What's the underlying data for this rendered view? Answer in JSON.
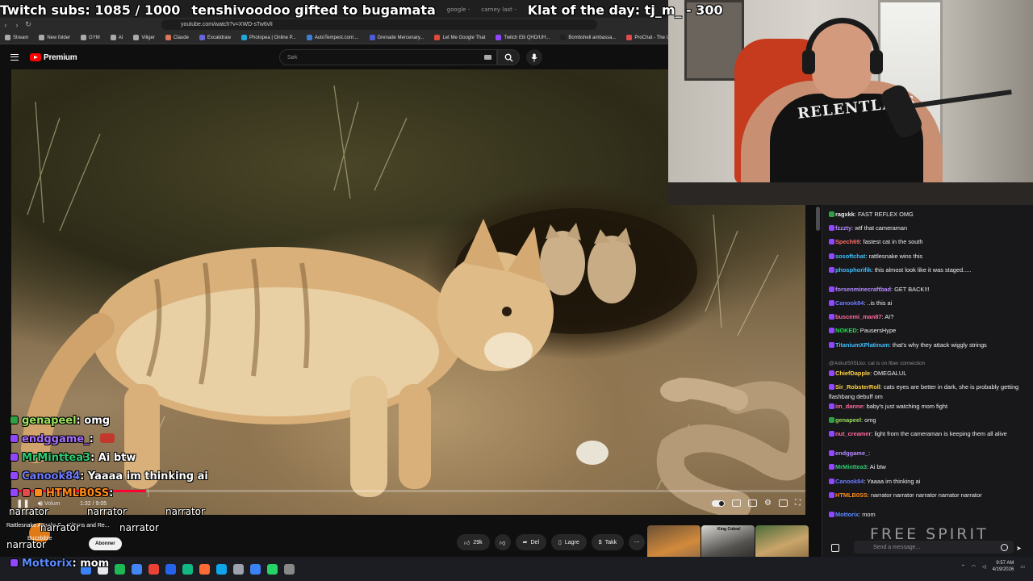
{
  "overlay": {
    "subs": "Twitch subs: 1085 / 1000",
    "gift": "tenshivoodoo gifted to bugamata",
    "klat": "Klat of the day: tj_m_ - 300",
    "ghost_tabs": [
      "google -",
      "carney last -"
    ]
  },
  "browser": {
    "url": "youtube.com/watch?v=XWD-sTw6vlI",
    "bookmarks": [
      {
        "label": "Stream",
        "color": "#aaaaaa"
      },
      {
        "label": "New folder",
        "color": "#aaaaaa"
      },
      {
        "label": "GYM",
        "color": "#aaaaaa"
      },
      {
        "label": "AI",
        "color": "#aaaaaa"
      },
      {
        "label": "Viliger",
        "color": "#aaaaaa"
      },
      {
        "label": "Claude",
        "color": "#d97757"
      },
      {
        "label": "Excalidraw",
        "color": "#6965db"
      },
      {
        "label": "Photopea | Online P...",
        "color": "#1fa5d8"
      },
      {
        "label": "AutoTempest.com:...",
        "color": "#3b7ed8"
      },
      {
        "label": "Grenade Mercenary...",
        "color": "#4e5cd6"
      },
      {
        "label": "Let Me Google That",
        "color": "#e24a36"
      },
      {
        "label": "Twitch Elli QHD/UH...",
        "color": "#9146ff"
      },
      {
        "label": "Bombshell ambassa...",
        "color": "#222222"
      },
      {
        "label": "ProChat - The Unifi...",
        "color": "#e14b4b"
      }
    ]
  },
  "youtube": {
    "logo": "Premium",
    "search_placeholder": "Søk",
    "time": "1:32 / 9:05",
    "progress_fraction": 0.17,
    "actions": {
      "likes": "29k",
      "share": "Del",
      "save": "Lagre",
      "thanks": "Takk"
    },
    "subscribe": "Abonner",
    "channel": "Buzzbible",
    "thumb_label": "King Cobra!"
  },
  "overlay_chat": [
    {
      "user": "genapeel",
      "message": ": omg",
      "color": "#9be15d",
      "badge": "#2ea043"
    },
    {
      "user": "endggame_",
      "message": ":",
      "color": "#a970ff",
      "badge": "#9146ff"
    },
    {
      "user": "MrMinttea3",
      "message": ": Ai btw",
      "color": "#2ecc71",
      "badge": "#9146ff"
    },
    {
      "user": "Canook84",
      "message": ": Yaaaa im thinking ai",
      "color": "#6e7bff",
      "badge": "#9146ff"
    },
    {
      "user": "HTMLB0SS",
      "message": ":",
      "color": "#ff8c1a",
      "badge": "#9146ff"
    },
    {
      "user": "Mottorix",
      "message": ": mom",
      "color": "#5b8cff",
      "badge": "#9146ff"
    }
  ],
  "overlay_narrator": [
    "narrator",
    "narrator",
    "narrator",
    "narrator",
    "narrator",
    "narrator"
  ],
  "overlay_misc": {
    "volume": "Volum",
    "title_ghost": "Rattlesnake Attacks S... Kittens and Re..."
  },
  "chat": {
    "messages": [
      {
        "user": "ragxkk",
        "text": ": FAST REFLEX OMG",
        "color": "#efeff1",
        "badge": "#2ea043"
      },
      {
        "user": "fzzzty",
        "text": ": wtf that cameraman",
        "color": "#b58cff",
        "badge": "#9146ff"
      },
      {
        "user": "Spech69",
        "text": ": fastest cat in the south",
        "color": "#ff6b6b",
        "badge": "#9146ff"
      },
      {
        "user": "sosoftchat",
        "text": ": rattlesnake wins this",
        "color": "#3ec1ff",
        "badge": "#9146ff"
      },
      {
        "user": "phosphorifik",
        "text": ": this almost look like it was staged.....",
        "color": "#3ec1ff",
        "badge": "#9146ff"
      },
      {
        "user": "forsenminecraftbad",
        "text": ":  GET BACK!!!",
        "color": "#b58cff",
        "badge": "#9146ff"
      },
      {
        "user": "Canook84",
        "text": ": ..is this ai",
        "color": "#6e7bff",
        "badge": "#9146ff"
      },
      {
        "user": "buscemi_man87",
        "text": ": AI?",
        "color": "#ff6b9a",
        "badge": "#9146ff"
      },
      {
        "user": "NOKED",
        "text": ": PausersHype",
        "color": "#22dd55",
        "badge": "#9146ff"
      },
      {
        "user": "TitaniumXPlatinum",
        "text": ":  that's why they attack wiggly strings",
        "color": "#3ec1ff",
        "badge": "#9146ff"
      },
      {
        "user": "ChiefDapple",
        "text": ": OMEGALUL",
        "color": "#ffd23f",
        "badge": "#9146ff"
      },
      {
        "user": "Sir_RobsterRoll",
        "text": ": cats eyes are better in dark, she is probably getting flashbang debuff om",
        "color": "#ffd23f",
        "badge": "#9146ff"
      },
      {
        "user": "im_danne",
        "text": ": baby's just watching mom fight",
        "color": "#ff6b9a",
        "badge": "#9146ff"
      },
      {
        "user": "genapeel",
        "text": ": omg",
        "color": "#9be15d",
        "badge": "#2ea043"
      },
      {
        "user": "nut_creamer",
        "text": ": light from the cameraman is keeping them all alive",
        "color": "#ff6b9a",
        "badge": "#9146ff"
      },
      {
        "user": "endggame_",
        "text": ":",
        "color": "#b58cff",
        "badge": "#9146ff"
      },
      {
        "user": "MrMinttea3",
        "text": ": Ai btw",
        "color": "#2ecc71",
        "badge": "#9146ff"
      },
      {
        "user": "Canook84",
        "text": ": Yaaaa im thinking ai",
        "color": "#6e7bff",
        "badge": "#9146ff"
      },
      {
        "user": "HTMLB0SS",
        "text": ": narrator  narrator  narrator  narrator  narrator",
        "color": "#ff8c1a",
        "badge": "#9146ff"
      },
      {
        "user": "Mottorix",
        "text": ": mom",
        "color": "#5b8cff",
        "badge": "#9146ff"
      }
    ],
    "system_line": "@Ankur50SLko: cat is on fiber connection",
    "input_placeholder": "Send a message...",
    "watermark": "FREE SPIRIT"
  },
  "webcam": {
    "shirt_text": "RELENTLESS"
  },
  "taskbar": {
    "time": "9:57 AM",
    "date": "4/19/2026",
    "icon_colors": [
      "#3b82f6",
      "#e5e7eb",
      "#1db954",
      "#4285f4",
      "#ea4335",
      "#2563eb",
      "#10b981",
      "#ff6b35",
      "#0ea5e9",
      "#9ca3af",
      "#3b82f6",
      "#25d366",
      "#888888"
    ]
  }
}
